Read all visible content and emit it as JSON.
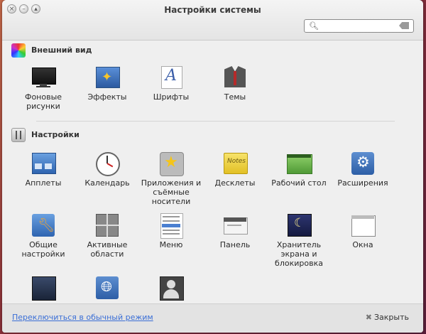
{
  "window": {
    "title": "Настройки системы"
  },
  "search": {
    "value": "",
    "placeholder": ""
  },
  "sections": {
    "appearance": {
      "title": "Внешний вид",
      "items": [
        "Фоновые рисунки",
        "Эффекты",
        "Шрифты",
        "Темы"
      ]
    },
    "preferences": {
      "title": "Настройки",
      "items": [
        "Апплеты",
        "Календарь",
        "Приложения и съёмные носители",
        "Десклеты",
        "Рабочий стол",
        "Расширения",
        "Общие настройки",
        "Активные области",
        "Меню",
        "Панель",
        "Хранитель экрана и блокировка",
        "Окна"
      ]
    }
  },
  "footer": {
    "switch_mode": "Переключиться в обычный режим",
    "close": "Закрыть"
  }
}
